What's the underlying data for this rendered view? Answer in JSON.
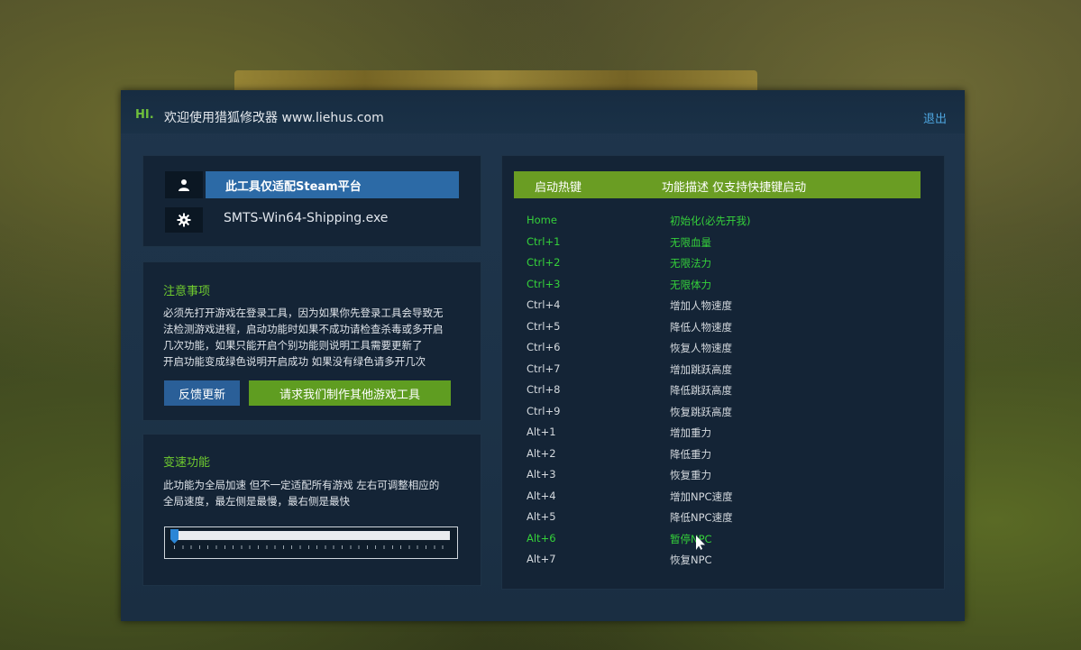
{
  "header": {
    "hi": "HI.",
    "welcome": "欢迎使用猎狐修改器 www.liehus.com",
    "exit": "退出"
  },
  "platform": {
    "steam_label": "此工具仅适配Steam平台",
    "process": "SMTS-Win64-Shipping.exe"
  },
  "notice": {
    "title": "注意事项",
    "lines": [
      "必须先打开游戏在登录工具，因为如果你先登录工具会导致无",
      "法检测游戏进程，启动功能时如果不成功请检查杀毒或多开启",
      "几次功能，如果只能开启个别功能则说明工具需要更新了",
      "开启功能变成绿色说明开启成功 如果没有绿色请多开几次"
    ],
    "feedback_button": "反馈更新",
    "request_button": "请求我们制作其他游戏工具"
  },
  "speed": {
    "title": "变速功能",
    "lines": [
      "此功能为全局加速 但不一定适配所有游戏 左右可调整相应的",
      "全局速度，最左侧是最慢，最右侧是最快"
    ],
    "slider_value": 0
  },
  "hotkeys": {
    "col_key": "启动热键",
    "col_desc": "功能描述 仅支持快捷键启动",
    "rows": [
      {
        "key": "Home",
        "desc": "初始化(必先开我)",
        "active": true
      },
      {
        "key": "Ctrl+1",
        "desc": "无限血量",
        "active": true
      },
      {
        "key": "Ctrl+2",
        "desc": "无限法力",
        "active": true
      },
      {
        "key": "Ctrl+3",
        "desc": "无限体力",
        "active": true
      },
      {
        "key": "Ctrl+4",
        "desc": "增加人物速度",
        "active": false
      },
      {
        "key": "Ctrl+5",
        "desc": "降低人物速度",
        "active": false
      },
      {
        "key": "Ctrl+6",
        "desc": "恢复人物速度",
        "active": false
      },
      {
        "key": "Ctrl+7",
        "desc": "增加跳跃高度",
        "active": false
      },
      {
        "key": "Ctrl+8",
        "desc": "降低跳跃高度",
        "active": false
      },
      {
        "key": "Ctrl+9",
        "desc": "恢复跳跃高度",
        "active": false
      },
      {
        "key": "Alt+1",
        "desc": "增加重力",
        "active": false
      },
      {
        "key": "Alt+2",
        "desc": "降低重力",
        "active": false
      },
      {
        "key": "Alt+3",
        "desc": "恢复重力",
        "active": false
      },
      {
        "key": "Alt+4",
        "desc": "增加NPC速度",
        "active": false
      },
      {
        "key": "Alt+5",
        "desc": "降低NPC速度",
        "active": false
      },
      {
        "key": "Alt+6",
        "desc": "暂停NPC",
        "active": true
      },
      {
        "key": "Alt+7",
        "desc": "恢复NPC",
        "active": false
      }
    ]
  },
  "colors": {
    "active": "#35d13a",
    "inactive": "#d4d9de",
    "accent_green": "#6a9d23",
    "accent_blue": "#2c6aa6"
  },
  "icons": {
    "user": "user-icon",
    "gear": "gear-icon"
  }
}
